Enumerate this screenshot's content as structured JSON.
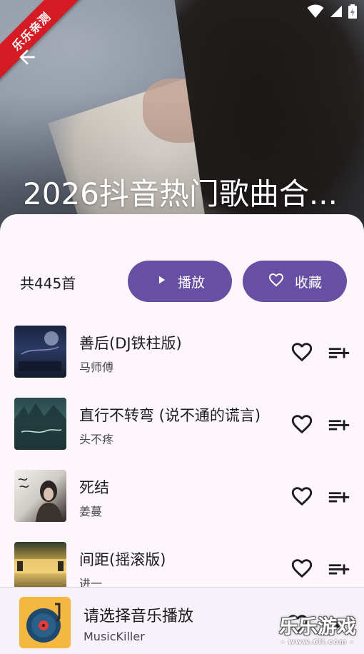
{
  "header": {
    "title": "2026抖音热门歌曲合...",
    "ribbon_text": "乐乐亲测"
  },
  "summary": {
    "count_text": "共445首",
    "play_label": "播放",
    "favorite_label": "收藏"
  },
  "songs": [
    {
      "title": "善后(DJ铁柱版)",
      "artist": "马师傅"
    },
    {
      "title": "直行不转弯 (说不通的谎言)",
      "artist": "头不疼"
    },
    {
      "title": "死结",
      "artist": "姜蔓"
    },
    {
      "title": "间距(摇滚版)",
      "artist": "进一"
    }
  ],
  "player": {
    "title": "请选择音乐播放",
    "subtitle": "MusicKiller"
  },
  "watermark": {
    "main": "乐乐游戏",
    "sub": "- www.6ll.com -"
  },
  "colors": {
    "accent": "#6750a4",
    "ribbon": "#d51c24",
    "background": "#fdf7fb"
  },
  "icons": {
    "back": "arrow-back-icon",
    "play": "play-icon",
    "favorite": "heart-outline-icon",
    "add_to_queue": "playlist-add-icon",
    "wifi": "wifi-icon",
    "battery": "battery-icon"
  }
}
